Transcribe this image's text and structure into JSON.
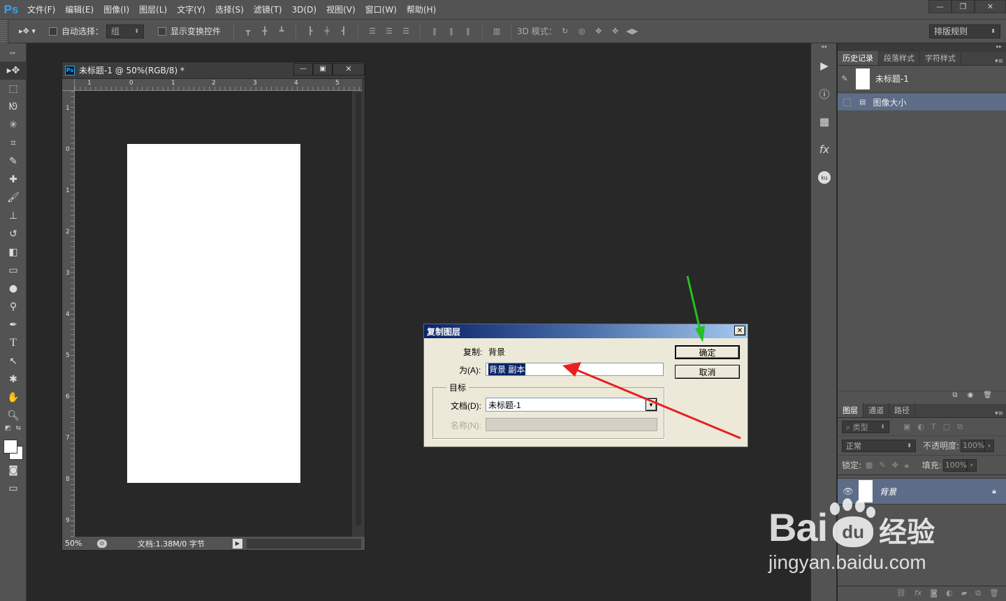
{
  "app": {
    "logo": "Ps"
  },
  "menu": [
    "文件(F)",
    "编辑(E)",
    "图像(I)",
    "图层(L)",
    "文字(Y)",
    "选择(S)",
    "滤镜(T)",
    "3D(D)",
    "视图(V)",
    "窗口(W)",
    "帮助(H)"
  ],
  "window_controls": {
    "minimize": "—",
    "restore": "❐",
    "close": "✕"
  },
  "options": {
    "auto_select_label": "自动选择：",
    "auto_select_value": "组",
    "show_transform_label": "显示变换控件",
    "mode_3d_label": "3D 模式：",
    "workspace_value": "排版规则"
  },
  "document": {
    "title": "未标题-1 @ 50%(RGB/8) *",
    "zoom": "50%",
    "status": "文档:1.38M/0 字节",
    "ruler_top": [
      "1",
      "0",
      "1",
      "2",
      "3",
      "4",
      "5"
    ],
    "ruler_left": [
      "1",
      "0",
      "1",
      "2",
      "3",
      "4",
      "5",
      "6",
      "7",
      "8",
      "9"
    ]
  },
  "history_panel": {
    "tabs": [
      "历史记录",
      "段落样式",
      "字符样式"
    ],
    "snapshot_label": "未标题-1",
    "steps": [
      "图像大小"
    ]
  },
  "layers_panel": {
    "tabs": [
      "图层",
      "通道",
      "路径"
    ],
    "filter_label": "类型",
    "blend_mode": "正常",
    "opacity_label": "不透明度:",
    "opacity_value": "100%",
    "lock_label": "锁定:",
    "fill_label": "填充:",
    "fill_value": "100%",
    "layers": [
      {
        "name": "背景"
      }
    ]
  },
  "dialog": {
    "title": "复制图层",
    "copy_label": "复制:",
    "copy_value": "背景",
    "as_label": "为(A):",
    "as_value": "背景 副本",
    "target_group": "目标",
    "document_label": "文档(D):",
    "document_value": "未标题-1",
    "name_label": "名称(N):",
    "name_value": "",
    "ok_label": "确定",
    "cancel_label": "取消"
  },
  "watermark": {
    "brand": "Bai",
    "brand2": "du",
    "jy": "经验",
    "url": "jingyan.baidu.com"
  }
}
